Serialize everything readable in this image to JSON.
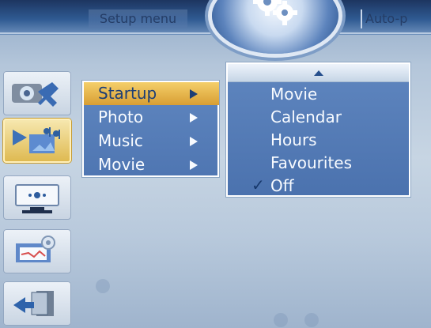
{
  "header": {
    "title": "Setup menu",
    "right_label": "Auto-p"
  },
  "submenu": {
    "items": [
      {
        "label": "Startup",
        "selected": true
      },
      {
        "label": "Photo",
        "selected": false
      },
      {
        "label": "Music",
        "selected": false
      },
      {
        "label": "Movie",
        "selected": false
      }
    ]
  },
  "dropdown": {
    "items": [
      {
        "label": "Movie",
        "checked": false
      },
      {
        "label": "Calendar",
        "checked": false
      },
      {
        "label": "Hours",
        "checked": false
      },
      {
        "label": "Favourites",
        "checked": false
      },
      {
        "label": "Off",
        "checked": true
      }
    ]
  },
  "icons": {
    "left_column": [
      "camera-wrench-icon",
      "media-settings-icon",
      "display-settings-icon",
      "calendar-gear-icon",
      "back-door-icon"
    ],
    "hub": "gears-icon",
    "check": "checkmark-icon"
  },
  "colors": {
    "selected": "#d89e33",
    "menu_blue": "#5f86bf",
    "text_light": "#f8fbff",
    "header_blue": "#2f5a92"
  }
}
